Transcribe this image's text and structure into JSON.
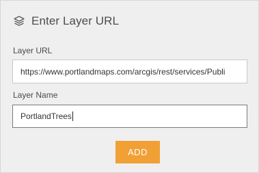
{
  "header": {
    "icon": "layers-icon",
    "title": "Enter Layer URL"
  },
  "form": {
    "url_label": "Layer URL",
    "url_value": "https://www.portlandmaps.com/arcgis/rest/services/Publi",
    "name_label": "Layer Name",
    "name_value": "PortlandTrees"
  },
  "actions": {
    "add_label": "ADD"
  },
  "colors": {
    "panel_background": "#efefef",
    "accent_button": "#f0a034",
    "focused_border": "#7a7a7a"
  }
}
